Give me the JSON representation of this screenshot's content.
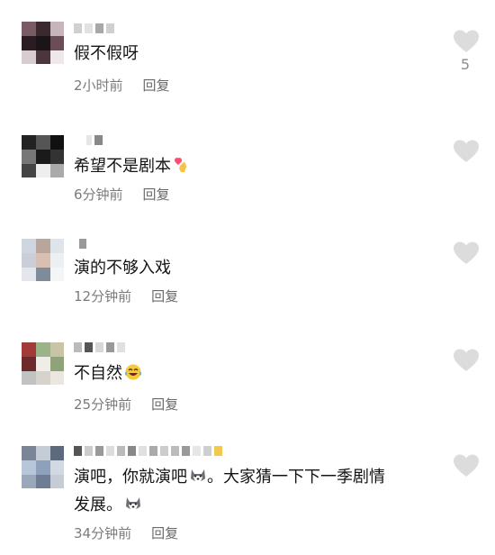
{
  "comments": [
    {
      "text": "假不假呀",
      "time": "2小时前",
      "reply": "回复",
      "likes": "5",
      "emoji": ""
    },
    {
      "text": "希望不是剧本",
      "time": "6分钟前",
      "reply": "回复",
      "likes": "",
      "emoji": "finger-heart"
    },
    {
      "text": "演的不够入戏",
      "time": "12分钟前",
      "reply": "回复",
      "likes": "",
      "emoji": ""
    },
    {
      "text": "不自然",
      "time": "25分钟前",
      "reply": "回复",
      "likes": "",
      "emoji": "laugh-tears"
    },
    {
      "text_line1": "演吧，你就演吧",
      "text_line1_mid": "。大家猜一下下一季剧情",
      "text_line2": "发展。",
      "time": "34分钟前",
      "reply": "回复",
      "likes": "",
      "emoji": "husky"
    }
  ],
  "icons": {
    "like": "heart-outline-icon",
    "emojis": [
      "finger-heart-icon",
      "laugh-tears-icon",
      "husky-icon"
    ]
  },
  "colors": {
    "text": "#141414",
    "meta": "#7b7b7b",
    "heart": "#d9d9d9"
  }
}
